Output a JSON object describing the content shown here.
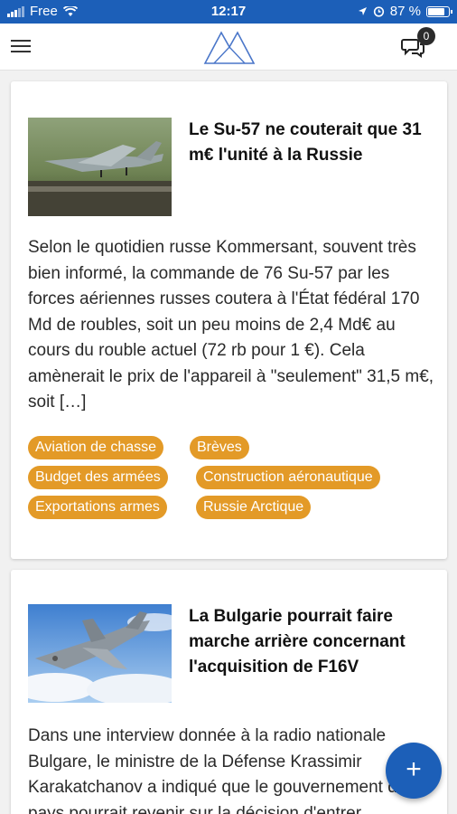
{
  "status_bar": {
    "carrier": "Free",
    "time": "12:17",
    "battery_percent": "87 %",
    "battery_level": 0.87
  },
  "header": {
    "chat_count": "0"
  },
  "articles": [
    {
      "title": "Le Su-57 ne couterait que 31 m€ l'unité à la Russie",
      "excerpt": "Selon le quotidien russe Kommersant, souvent très bien informé, la commande de 76 Su-57 par les forces aériennes russes coutera à l'État fédéral 170 Md de roubles, soit un peu moins de 2,4 Md€ au cours du rouble actuel (72 rb pour 1 €). Cela amènerait le prix de l'appareil à \"seulement\" 31,5 m€, soit […]",
      "tags": [
        "Aviation de chasse",
        "Brèves",
        "Budget des armées",
        "Construction aéronautique",
        "Exportations armes",
        "Russie Arctique"
      ]
    },
    {
      "title": "La Bulgarie pourrait faire marche arrière concernant l'acquisition de F16V",
      "excerpt": "Dans une interview donnée à la radio nationale Bulgare, le ministre de la Défense Krassimir Karakatchanov a indiqué que le gouvernement du pays pourrait revenir sur la décision d'entrer"
    }
  ],
  "fab": {
    "label": "+"
  },
  "colors": {
    "brand_blue": "#1c5fb8",
    "tag_orange": "#e39a27"
  }
}
